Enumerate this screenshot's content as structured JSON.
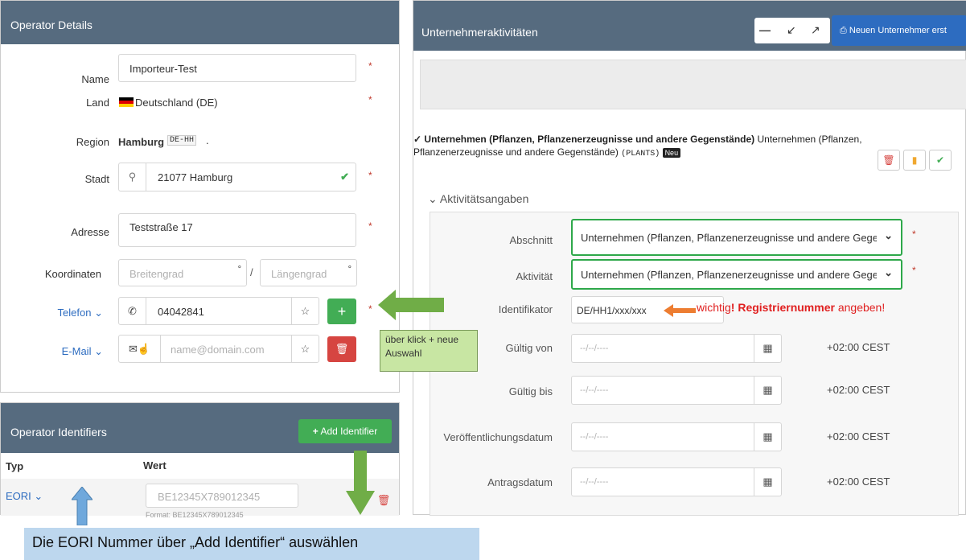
{
  "operator": {
    "title": "Operator Details",
    "name_label": "Name",
    "name_value": "Importeur-Test",
    "land_label": "Land",
    "land_value": "Deutschland (DE)",
    "region_label": "Region",
    "region_value": "Hamburg",
    "region_code": "DE-HH",
    "region_dot": ".",
    "stadt_label": "Stadt",
    "stadt_value": "21077 Hamburg",
    "adresse_label": "Adresse",
    "adresse_value": "Teststraße 17",
    "koord_label": "Koordinaten",
    "breiten_ph": "Breitengrad",
    "laengen_ph": "Längengrad",
    "deg": "°",
    "slash": "/",
    "telefon_label": "Telefon",
    "telefon_value": "04042841",
    "email_label": "E-Mail",
    "email_ph": "name@domain.com",
    "req": "*"
  },
  "identifiers": {
    "title": "Operator Identifiers",
    "add_button": "Add Identifier",
    "col_typ": "Typ",
    "col_wert": "Wert",
    "row_typ": "EORI",
    "row_value_ph": "BE12345X789012345",
    "row_hint": "Format: BE12345X789012345"
  },
  "callouts": {
    "klick": "über klick + neue Auswahl",
    "eori": "Die EORI Nummer über „Add Identifier“ auswählen",
    "wichtig_pre": "wichtig",
    "wichtig_bold": "! Registriernummer",
    "wichtig_post": " angeben!"
  },
  "activities": {
    "title": "Unternehmeraktivitäten",
    "new_button": "Neuen Unternehmer erst",
    "section_bold": "Unternehmen (Pflanzen, Pflanzenerzeugnisse und andere Gegenstände)",
    "section_rest": " Unternehmen (Pflanzen,",
    "section_line2": "Pflanzenerzeugnisse und andere Gegenstände)",
    "section_code": "(PLANTS)",
    "badge_new": "Neu",
    "sub_title": "Aktivitätsangaben",
    "abschnitt_label": "Abschnitt",
    "abschnitt_value": "Unternehmen (Pflanzen, Pflanzenerzeugnisse und andere Gege",
    "aktivitaet_label": "Aktivität",
    "aktivitaet_value": "Unternehmen (Pflanzen, Pflanzenerzeugnisse und andere Gege",
    "ident_label": "Identifikator",
    "ident_value": "DE/HH1/xxx/xxx",
    "gueltig_von_label": "Gültig von",
    "gueltig_bis_label": "Gültig bis",
    "veroeff_label": "Veröffentlichungsdatum",
    "antrag_label": "Antragsdatum",
    "date_ph": "--/--/----",
    "tz": "+02:00 CEST",
    "req": "*"
  },
  "colors": {
    "header": "#566b7f",
    "green": "#42ad55",
    "red": "#d64541",
    "blue": "#2d6cc0",
    "callout_green": "#c8e6a3"
  }
}
